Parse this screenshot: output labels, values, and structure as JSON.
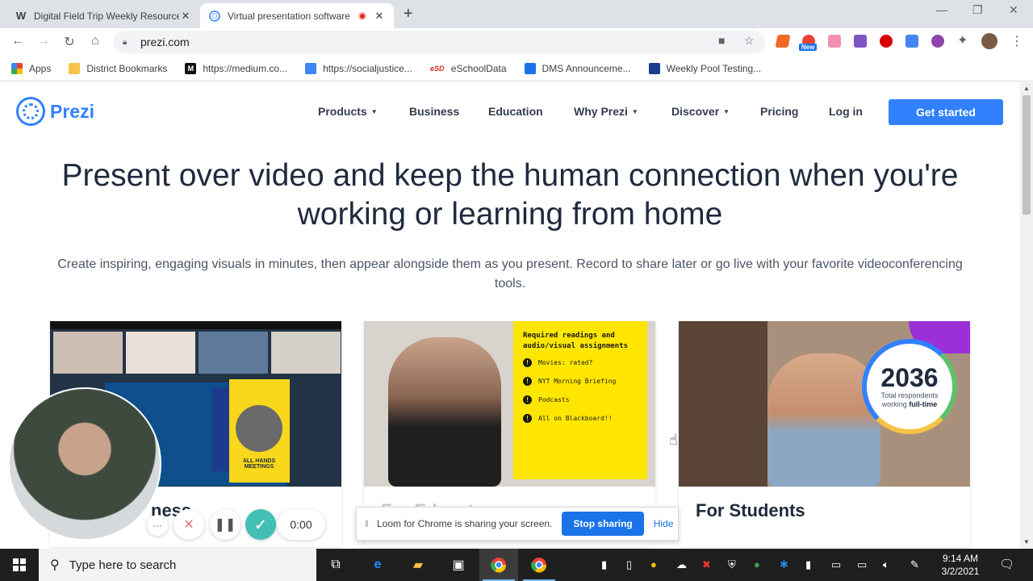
{
  "browser": {
    "tabs": [
      {
        "title": "Digital Field Trip Weekly Resource",
        "favicon": "W",
        "active": false,
        "close": "✕"
      },
      {
        "title": "Virtual presentation software",
        "favicon": "prezi",
        "active": true,
        "close": "✕"
      }
    ],
    "new_tab": "+",
    "url": "prezi.com",
    "ext_new_badge": "New"
  },
  "bookmarks": [
    {
      "label": "Apps",
      "icon": "apps-grid-icon"
    },
    {
      "label": "District Bookmarks",
      "icon": "folder-icon"
    },
    {
      "label": "https://medium.co...",
      "icon": "medium-icon",
      "glyph": "M"
    },
    {
      "label": "https://socialjustice...",
      "icon": "docs-icon"
    },
    {
      "label": "eSchoolData",
      "icon": "esd-icon",
      "glyph": "eSD"
    },
    {
      "label": "DMS Announceme...",
      "icon": "dms-icon"
    },
    {
      "label": "Weekly Pool Testing...",
      "icon": "pool-icon"
    }
  ],
  "site": {
    "logo_text": "Prezi",
    "nav": [
      {
        "label": "Products",
        "dropdown": true
      },
      {
        "label": "Business",
        "dropdown": false
      },
      {
        "label": "Education",
        "dropdown": false
      },
      {
        "label": "Why Prezi",
        "dropdown": true
      },
      {
        "label": "Discover",
        "dropdown": true
      },
      {
        "label": "Pricing",
        "dropdown": false
      },
      {
        "label": "Log in",
        "dropdown": false
      }
    ],
    "cta": "Get started",
    "hero_title": "Present over video and keep the human connection when you're working or learning from home",
    "hero_subtitle": "Create inspiring, engaging visuals in minutes, then appear alongside them as you present. Record to share later or go live with your favorite videoconferencing tools.",
    "cards": [
      {
        "label": "For Business",
        "visible_label": "ness",
        "slide_text": "ALL HANDS MEETINGS"
      },
      {
        "label": "For Educators",
        "todo_title": "Required readings and audio/visual assignments",
        "todo_items": [
          "Movies: rated?",
          "NYT Morning Briefing",
          "Podcasts",
          "All on Blackboard!!"
        ]
      },
      {
        "label": "For Students",
        "stat_number": "2036",
        "stat_line1": "Total respondents",
        "stat_line2_prefix": "working ",
        "stat_line2_bold": "full-time"
      }
    ]
  },
  "loom": {
    "timer": "0:00",
    "more": "···",
    "cancel": "✕",
    "pause": "❚❚",
    "done": "✓",
    "share_message": "Loom for Chrome is sharing your screen.",
    "stop_sharing": "Stop sharing",
    "hide": "Hide"
  },
  "taskbar": {
    "search_placeholder": "Type here to search",
    "time": "9:14 AM",
    "date": "3/2/2021"
  },
  "colors": {
    "prezi_blue": "#3181ff",
    "chrome_blue": "#1a73e8",
    "loom_teal": "#42c0b5"
  }
}
